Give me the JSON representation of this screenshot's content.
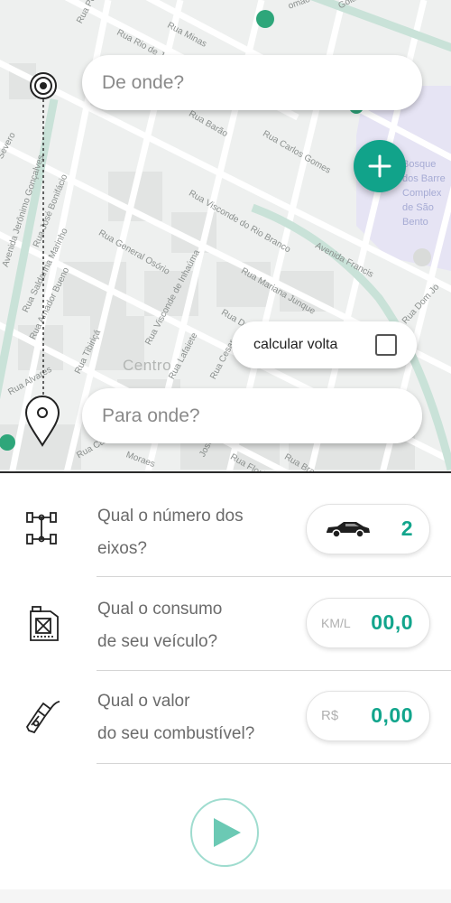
{
  "route": {
    "origin_placeholder": "De onde?",
    "destination_placeholder": "Para onde?",
    "round_trip_label": "calcular volta",
    "round_trip_checked": false
  },
  "map": {
    "district": "Centro",
    "poi": [
      "Bosque",
      "dos Barre",
      "Complex",
      "de São",
      "Bento"
    ],
    "streets": [
      "Rua Pom",
      "Rua Rio de Janei",
      "Rua Minas",
      "Goiás",
      "omão",
      "Rua Carlos Gomes",
      "Avenida Francis",
      "Rua Dom Jo",
      "Avenida Jerônimo Gonçalves",
      "Rua José Bonifácio",
      "Rua Saldanha Marinho",
      "Rua General Osório",
      "Rua Visconde do Rio Branco",
      "Rua Mariana Junque",
      "Rua Visconde de Inhaúma",
      "Rua Duque",
      "Rua Amador Bueno",
      "Rua Tibiriçá",
      "Rua Alvares",
      "Rua Florê",
      "Rua Brasília",
      "Rua Campos",
      "Moraes",
      "Rua Lafaiete",
      "Rua Cesar",
      "José",
      "Severo",
      "Rua Barão"
    ]
  },
  "form": {
    "axles": {
      "question": [
        "Qual o número dos",
        "eixos?"
      ],
      "value": "2"
    },
    "consumption": {
      "question": [
        "Qual o consumo",
        "de seu veículo?"
      ],
      "unit": "KM/L",
      "value": "00,0"
    },
    "fuel": {
      "question": [
        "Qual o valor",
        "do seu combustível?"
      ],
      "unit": "R$",
      "value": "0,00"
    }
  },
  "colors": {
    "accent": "#12a58c",
    "fab": "#11a38a",
    "play_border": "#9fdccf",
    "play_icon": "#6bc9b4"
  },
  "icons": {
    "origin": "target-icon",
    "destination": "location-pin-icon",
    "add": "plus-icon",
    "axles": "axle-icon",
    "car": "car-icon",
    "consumption": "fuel-can-icon",
    "fuel": "fuel-nozzle-icon",
    "play": "play-icon"
  }
}
